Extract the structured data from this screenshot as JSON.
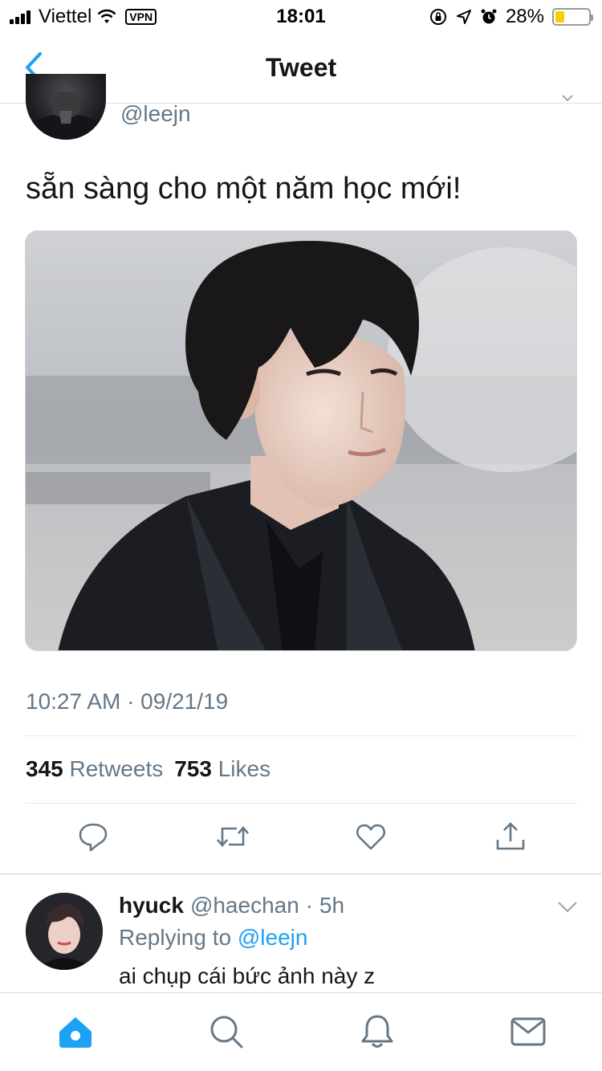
{
  "status_bar": {
    "carrier": "Viettel",
    "vpn": "VPN",
    "time": "18:01",
    "battery_percent": "28%",
    "battery_level": 0.28,
    "battery_color": "#f5cf00"
  },
  "nav": {
    "title": "Tweet",
    "back_icon": "chevron-left-icon",
    "accent": "#1da1f2"
  },
  "tweet": {
    "handle": "@leejn",
    "text": "sẵn sàng cho một năm học mới!",
    "timestamp": "10:27 AM · 09/21/19",
    "retweets_count": "345",
    "retweets_label": "Retweets",
    "likes_count": "753",
    "likes_label": "Likes",
    "actions": [
      "reply-icon",
      "retweet-icon",
      "like-icon",
      "share-icon"
    ]
  },
  "reply": {
    "name": "hyuck",
    "handle": "@haechan",
    "time": "· 5h",
    "replying_prefix": "Replying to",
    "replying_to": "@leejn",
    "text": "ai chụp cái bức ảnh này z"
  },
  "tabbar": {
    "items": [
      "home-icon",
      "search-icon",
      "notifications-icon",
      "messages-icon"
    ],
    "active": "home-icon"
  }
}
